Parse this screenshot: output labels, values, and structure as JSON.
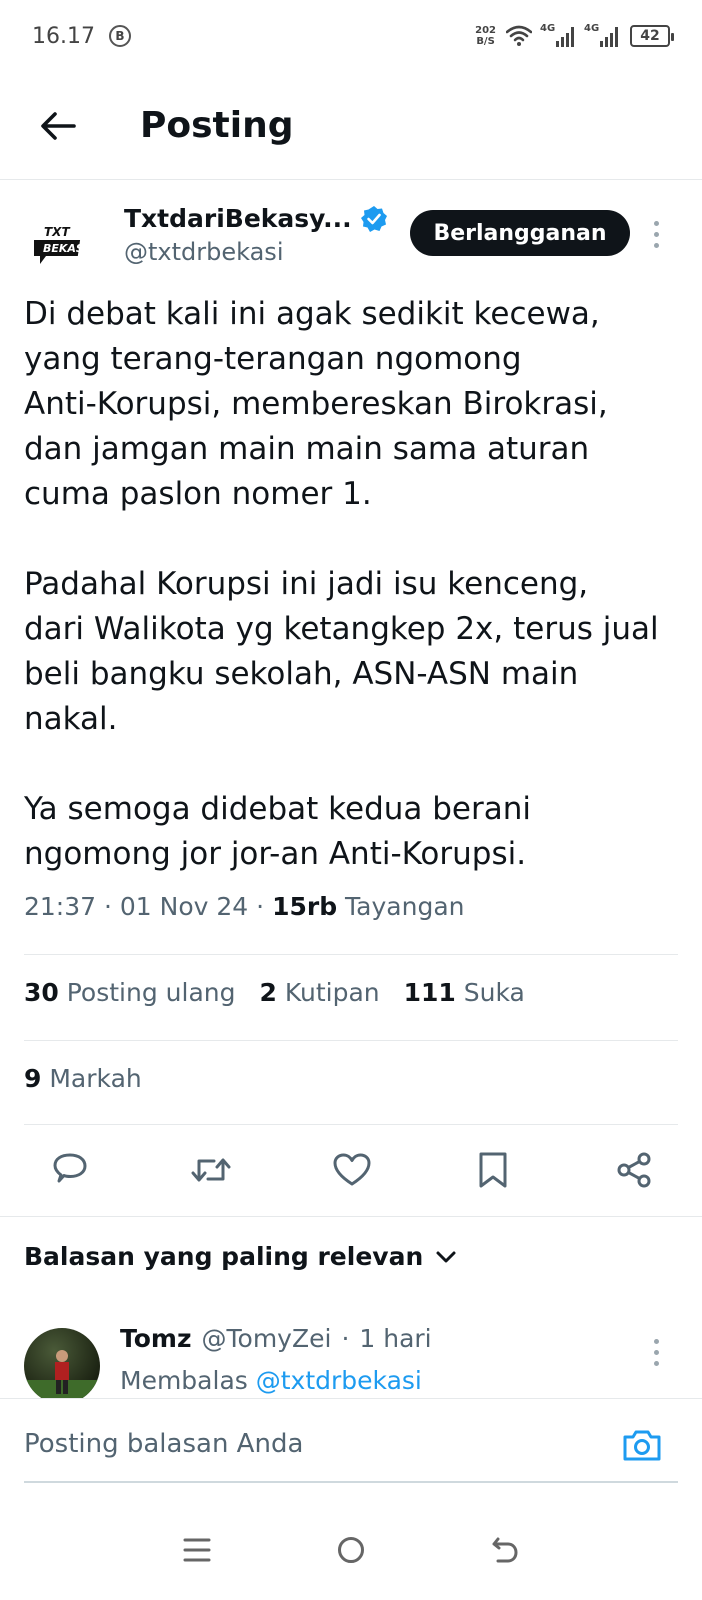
{
  "status_bar": {
    "time": "16.17",
    "b_badge": "B",
    "net_speed_value": "202",
    "net_speed_unit": "B/S",
    "signal1_label": "4G",
    "signal2_label": "4G",
    "battery": "42"
  },
  "header": {
    "title": "Posting"
  },
  "author": {
    "name": "TxtdariBekasy...",
    "handle": "@txtdrbekasi",
    "subscribe_label": "Berlangganan",
    "logo_line1": "TXT",
    "logo_line2": "BEKASI"
  },
  "post": {
    "paragraph1": "Di debat kali ini agak sedikit kecewa,\nyang terang-terangan ngomong\nAnti-Korupsi, membereskan Birokrasi,\ndan jamgan main main sama aturan\ncuma paslon nomer 1.",
    "paragraph2": "Padahal Korupsi ini jadi isu kenceng,\ndari Walikota yg ketangkep 2x, terus jual\nbeli bangku sekolah, ASN-ASN main\nnakal.",
    "paragraph3": "Ya semoga didebat kedua berani\nngomong jor jor-an Anti-Korupsi.",
    "time": "21:37",
    "date": "01 Nov 24",
    "views_count": "15rb",
    "views_label": "Tayangan"
  },
  "stats": {
    "reposts_count": "30",
    "reposts_label": "Posting ulang",
    "quotes_count": "2",
    "quotes_label": "Kutipan",
    "likes_count": "111",
    "likes_label": "Suka",
    "bookmarks_count": "9",
    "bookmarks_label": "Markah"
  },
  "replies": {
    "sort_label": "Balasan yang paling relevan",
    "items": [
      {
        "name": "Tomz",
        "handle": "@TomyZei",
        "time": "1 hari",
        "replying_prefix": "Membalas",
        "replying_to": "@txtdrbekasi"
      }
    ]
  },
  "composer": {
    "placeholder": "Posting balasan Anda"
  },
  "colors": {
    "accent": "#1d9bf0",
    "text_primary": "#0f1419",
    "text_secondary": "#536471"
  }
}
